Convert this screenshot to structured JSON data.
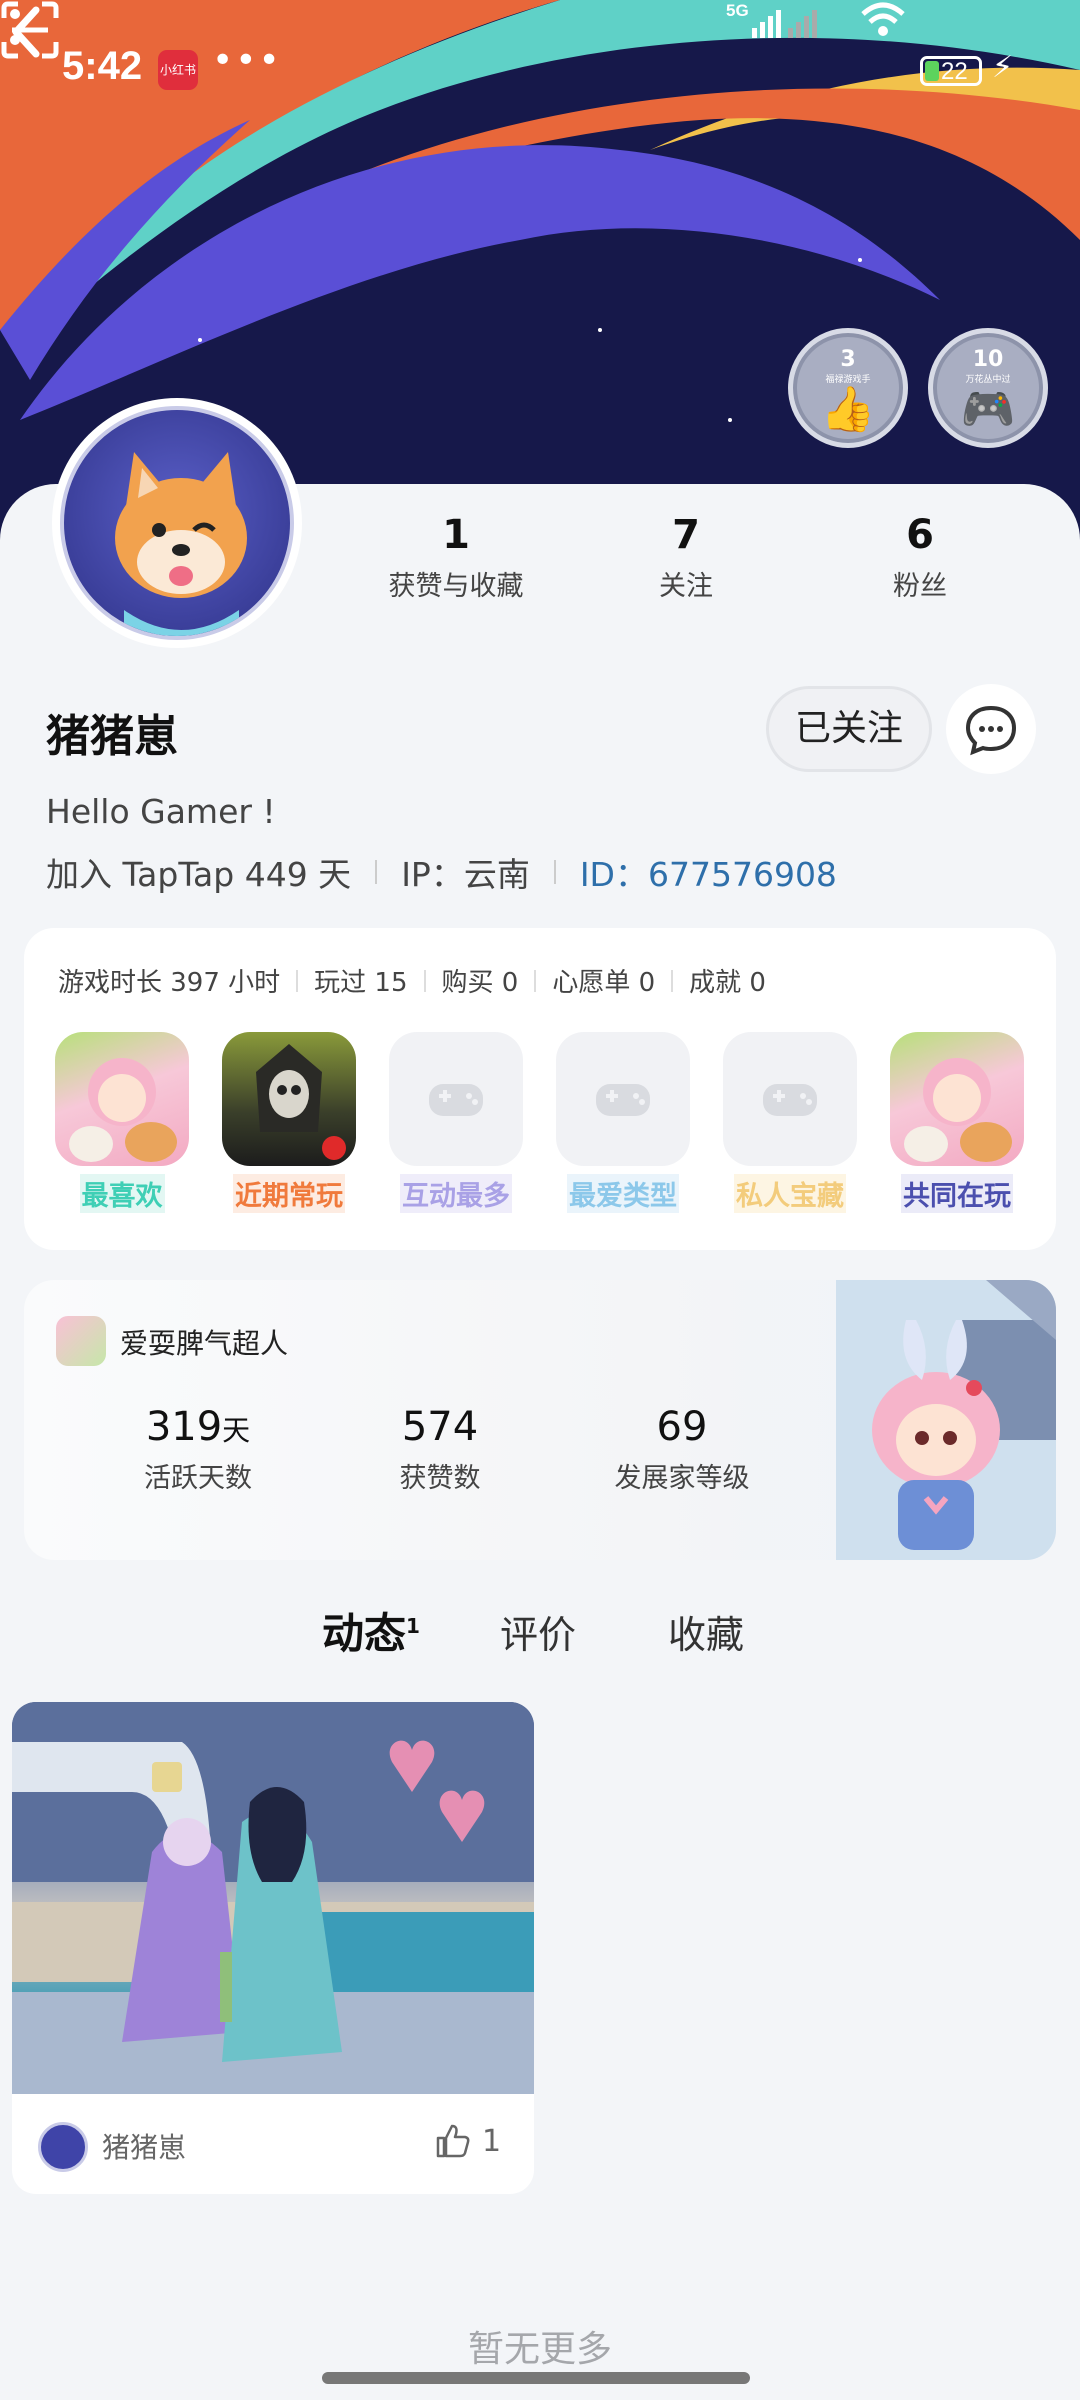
{
  "status_bar": {
    "time": "5:42",
    "app_badge": "小红书",
    "more_dots": "•••",
    "network": "5G",
    "battery": "22"
  },
  "header": {
    "medals": [
      {
        "count": "3",
        "text": "福禄游戏手",
        "icon": "thumbs-up-icon"
      },
      {
        "count": "10",
        "text": "万花丛中过",
        "icon": "gamepad-icon"
      }
    ]
  },
  "profile": {
    "stats": [
      {
        "value": "1",
        "label": "获赞与收藏"
      },
      {
        "value": "7",
        "label": "关注"
      },
      {
        "value": "6",
        "label": "粉丝"
      }
    ],
    "username": "猪猪崽",
    "follow_label": "已关注",
    "bio": "Hello Gamer !",
    "joined": "加入 TapTap 449 天",
    "ip": "IP：云南",
    "id": "ID：677576908"
  },
  "game_stats": {
    "items": [
      "游戏时长 397 小时",
      "玩过 15",
      "购买 0",
      "心愿单 0",
      "成就 0"
    ],
    "tiles": [
      {
        "label": "最喜欢",
        "color": "#3fcfb5",
        "bg": "#e3f7f3"
      },
      {
        "label": "近期常玩",
        "color": "#f07a3c",
        "bg": "#fdece2"
      },
      {
        "label": "互动最多",
        "color": "#a9a1e6",
        "bg": "#efedfa"
      },
      {
        "label": "最爱类型",
        "color": "#8cc8ea",
        "bg": "#eaf4fb"
      },
      {
        "label": "私人宝藏",
        "color": "#f3cc7c",
        "bg": "#fdf5e3"
      },
      {
        "label": "共同在玩",
        "color": "#4b4fae",
        "bg": "#ebebf8"
      }
    ]
  },
  "activity": {
    "game_name": "爱耍脾气超人",
    "stats": [
      {
        "value": "319",
        "unit": "天",
        "label": "活跃天数"
      },
      {
        "value": "574",
        "unit": "",
        "label": "获赞数"
      },
      {
        "value": "69",
        "unit": "",
        "label": "发展家等级"
      }
    ]
  },
  "tabs": [
    {
      "label": "动态",
      "badge": "1"
    },
    {
      "label": "评价",
      "badge": ""
    },
    {
      "label": "收藏",
      "badge": ""
    }
  ],
  "post": {
    "author": "猪猪崽",
    "likes": "1"
  },
  "footer": {
    "no_more": "暂无更多"
  }
}
